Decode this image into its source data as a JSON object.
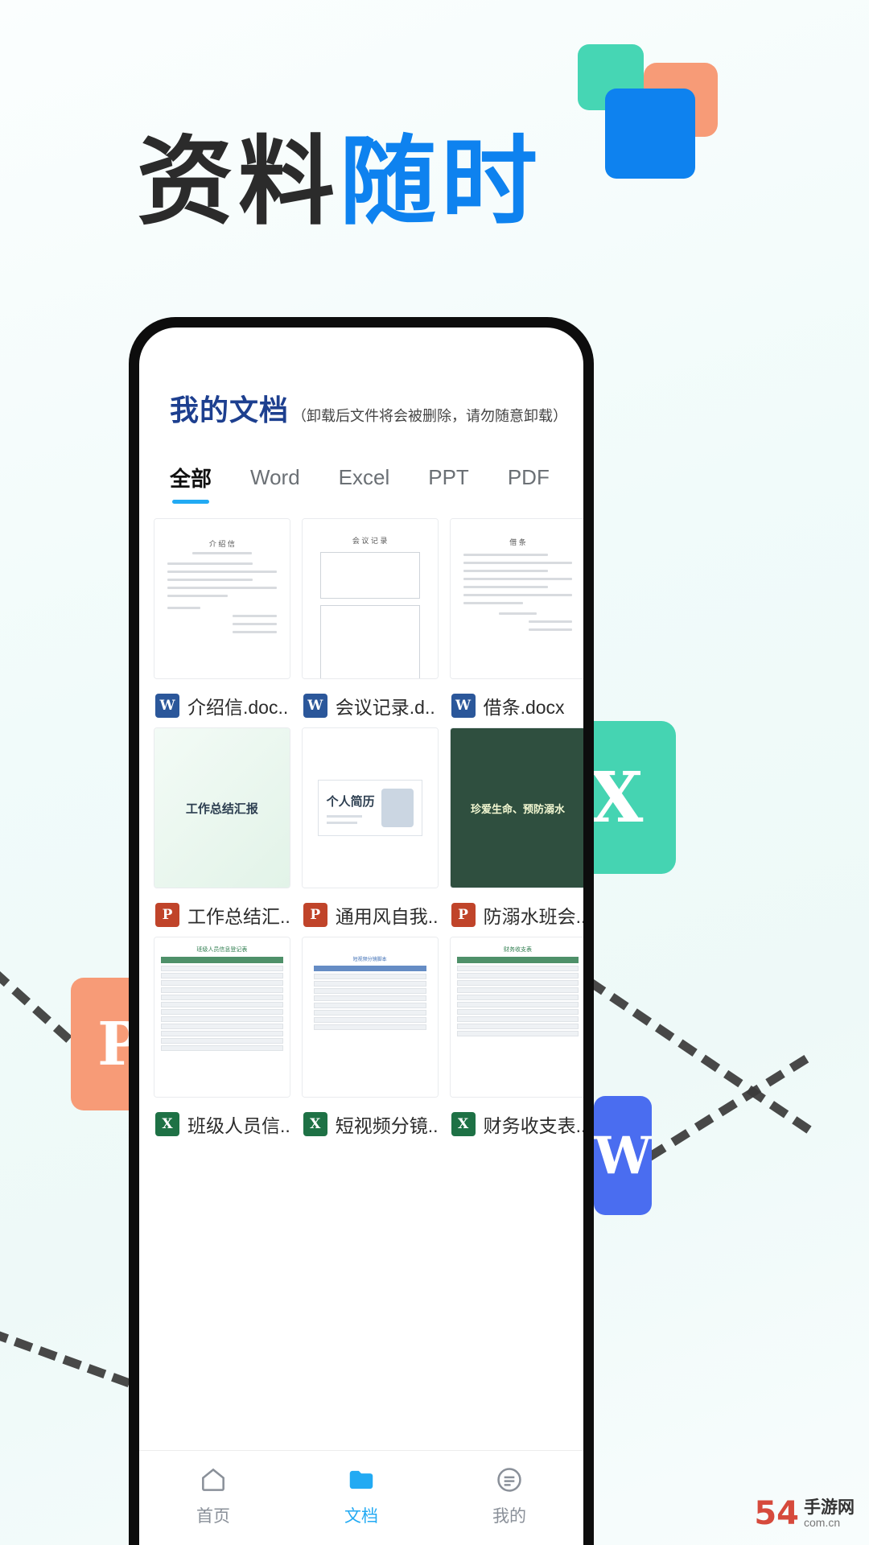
{
  "headline": {
    "part_dark": "资料",
    "part_blue": "随时"
  },
  "floating_tiles": [
    {
      "name": "excel-tile",
      "label": "X",
      "color": "#45d4b2"
    },
    {
      "name": "powerpoint-tile",
      "label": "P",
      "color": "#f79b77"
    },
    {
      "name": "word-tile",
      "label": "W",
      "color": "#4a6df0"
    }
  ],
  "phone": {
    "header": {
      "title": "我的文档",
      "note": "（卸载后文件将会被删除，请勿随意卸载）"
    },
    "tabs": [
      {
        "label": "全部",
        "active": true
      },
      {
        "label": "Word",
        "active": false
      },
      {
        "label": "Excel",
        "active": false
      },
      {
        "label": "PPT",
        "active": false
      },
      {
        "label": "PDF",
        "active": false
      }
    ],
    "files": [
      {
        "name": "介绍信.doc..",
        "type": "w",
        "badge": "W",
        "thumb": "letter",
        "thumb_title": "介 绍 信"
      },
      {
        "name": "会议记录.d..",
        "type": "w",
        "badge": "W",
        "thumb": "minutes",
        "thumb_title": "会 议 记 录"
      },
      {
        "name": "借条.docx",
        "type": "w",
        "badge": "W",
        "thumb": "iou",
        "thumb_title": "借 条"
      },
      {
        "name": "工作总结汇..",
        "type": "p",
        "badge": "P",
        "thumb": "slide-green",
        "thumb_title": "工作总结汇报"
      },
      {
        "name": "通用风自我..",
        "type": "p",
        "badge": "P",
        "thumb": "slide-resume",
        "thumb_title": "个人简历"
      },
      {
        "name": "防溺水班会..",
        "type": "p",
        "badge": "P",
        "thumb": "slide-chalk",
        "thumb_title": "珍爱生命、预防溺水"
      },
      {
        "name": "班级人员信..",
        "type": "x",
        "badge": "X",
        "thumb": "table-green",
        "thumb_title": "班级人员信息登记表"
      },
      {
        "name": "短视频分镜..",
        "type": "x",
        "badge": "X",
        "thumb": "table-blue",
        "thumb_title": "短视频分镜脚本"
      },
      {
        "name": "财务收支表..",
        "type": "x",
        "badge": "X",
        "thumb": "table-green2",
        "thumb_title": "财务收支表"
      }
    ],
    "tabbar": [
      {
        "label": "首页",
        "icon": "home-icon",
        "active": false
      },
      {
        "label": "文档",
        "icon": "document-icon",
        "active": true
      },
      {
        "label": "我的",
        "icon": "profile-icon",
        "active": false
      }
    ]
  },
  "watermark": {
    "number": "54",
    "line1": "手游网",
    "line2": "com.cn"
  },
  "colors": {
    "brand_blue": "#22aaf3",
    "title_blue": "#1d3f8f",
    "headline_blue": "#0e82ef",
    "green": "#45d4b2",
    "orange": "#f79b77"
  }
}
